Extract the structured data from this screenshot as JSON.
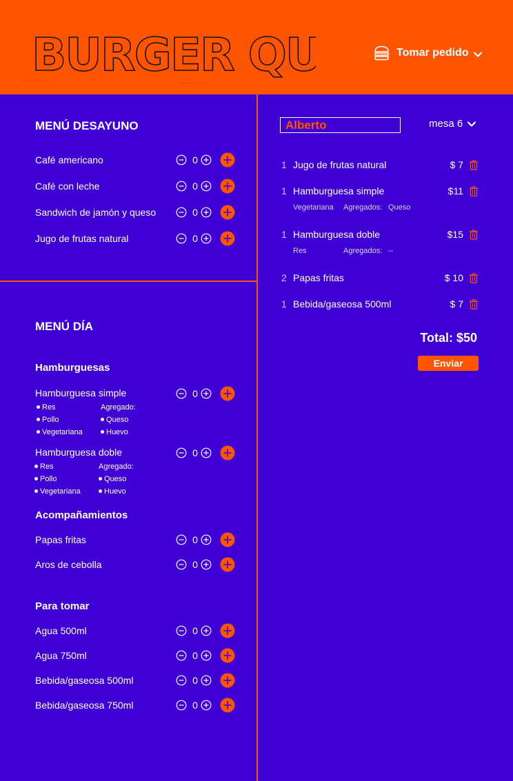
{
  "colors": {
    "accent": "#ff5500",
    "background": "#3e00d5",
    "text": "#ffffff"
  },
  "header": {
    "logo_text": "BURGER QUEEN",
    "take_order_label": "Tomar pedido",
    "take_order_icon": "burger-icon"
  },
  "breakfast": {
    "title": "MENÚ DESAYUNO",
    "items": [
      {
        "name": "Café americano",
        "qty": "0"
      },
      {
        "name": "Café con leche",
        "qty": "0"
      },
      {
        "name": "Sandwich de jamón y queso",
        "qty": "0"
      },
      {
        "name": "Jugo de frutas natural",
        "qty": "0"
      }
    ]
  },
  "day": {
    "title": "MENÚ DÍA",
    "burgers": {
      "title": "Hamburguesas",
      "items": [
        {
          "name": "Hamburguesa simple",
          "qty": "0",
          "types": [
            "Res",
            "Pollo",
            "Vegetariana"
          ],
          "extras_label": "Agregado:",
          "extras": [
            "Queso",
            "Huevo"
          ]
        },
        {
          "name": "Hamburguesa doble",
          "qty": "0",
          "types": [
            "Res",
            "Pollo",
            "Vegetariana"
          ],
          "extras_label": "Agregado:",
          "extras": [
            "Queso",
            "Huevo"
          ]
        }
      ]
    },
    "sides": {
      "title": "Acompañamientos",
      "items": [
        {
          "name": "Papas fritas",
          "qty": "0"
        },
        {
          "name": "Aros de cebolla",
          "qty": "0"
        }
      ]
    },
    "drinks": {
      "title": "Para tomar",
      "items": [
        {
          "name": "Agua 500ml",
          "qty": "0"
        },
        {
          "name": "Agua 750ml",
          "qty": "0"
        },
        {
          "name": "Bebida/gaseosa 500ml",
          "qty": "0"
        },
        {
          "name": "Bebida/gaseosa 750ml",
          "qty": "0"
        }
      ]
    }
  },
  "order": {
    "client_name": "Alberto",
    "table_label": "mesa 6",
    "lines": [
      {
        "qty": "1",
        "name": "Jugo de frutas natural",
        "price": "$ 7"
      },
      {
        "qty": "1",
        "name": "Hamburguesa simple",
        "price": "$11",
        "type": "Vegetariana",
        "extras_label": "Agregados:",
        "extras": "Queso"
      },
      {
        "qty": "1",
        "name": "Hamburguesa doble",
        "price": "$15",
        "type": "Res",
        "extras_label": "Agregados:",
        "extras": "--"
      },
      {
        "qty": "2",
        "name": "Papas fritas",
        "price": "$ 10"
      },
      {
        "qty": "1",
        "name": "Bebida/gaseosa 500ml",
        "price": "$ 7"
      }
    ],
    "total_label": "Total: $50",
    "send_label": "Enviar"
  }
}
